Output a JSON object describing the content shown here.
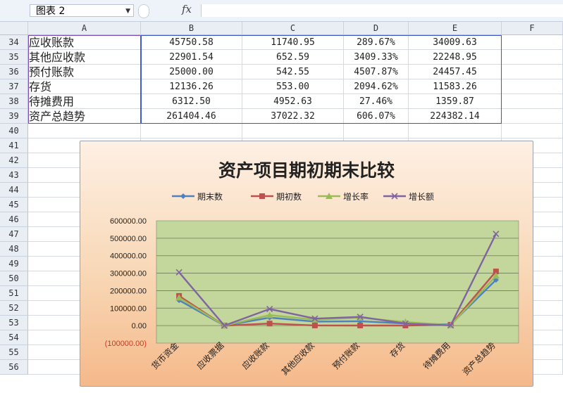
{
  "formula_bar": {
    "name_box": "图表 2",
    "fx_label": "fx",
    "formula": ""
  },
  "columns": [
    "A",
    "B",
    "C",
    "D",
    "E",
    "F"
  ],
  "rows": [
    {
      "num": "34",
      "a": "应收账款",
      "b": "45750.58",
      "c": "11740.95",
      "d": "289.67%",
      "e": "34009.63"
    },
    {
      "num": "35",
      "a": "其他应收款",
      "b": "22901.54",
      "c": "652.59",
      "d": "3409.33%",
      "e": "22248.95"
    },
    {
      "num": "36",
      "a": "预付账款",
      "b": "25000.00",
      "c": "542.55",
      "d": "4507.87%",
      "e": "24457.45"
    },
    {
      "num": "37",
      "a": "存货",
      "b": "12136.26",
      "c": "553.00",
      "d": "2094.62%",
      "e": "11583.26"
    },
    {
      "num": "38",
      "a": "待摊费用",
      "b": "6312.50",
      "c": "4952.63",
      "d": "27.46%",
      "e": "1359.87"
    },
    {
      "num": "39",
      "a": "资产总趋势",
      "b": "261404.46",
      "c": "37022.32",
      "d": "606.07%",
      "e": "224382.14"
    }
  ],
  "empty_rows": [
    "40",
    "41",
    "42",
    "43",
    "44",
    "45",
    "46",
    "47",
    "48",
    "49",
    "50",
    "51",
    "52",
    "53",
    "54",
    "55",
    "56"
  ],
  "colors": {
    "plot_bg": "#c3d69b",
    "期末数": "#4f81bd",
    "期初数": "#c0504d",
    "增长率": "#9bbb59",
    "增长额": "#8064a2",
    "negative_tick": "#e03020"
  },
  "chart_data": {
    "type": "line",
    "title": "资产项目期初期末比较",
    "categories": [
      "货币资金",
      "应收票据",
      "应收账款",
      "其他应收款",
      "预付账款",
      "存货",
      "待摊费用",
      "资产总趋势"
    ],
    "ylim": [
      -100000,
      600000
    ],
    "yticks": [
      "(100000.00)",
      "0.00",
      "100000.00",
      "200000.00",
      "300000.00",
      "400000.00",
      "500000.00",
      "600000.00"
    ],
    "ytick_values": [
      -100000,
      0,
      100000,
      200000,
      300000,
      400000,
      500000,
      600000
    ],
    "legend_position": "top",
    "grid": true,
    "series": [
      {
        "name": "期末数",
        "marker": "diamond",
        "values": [
          145000,
          0,
          45750.58,
          22901.54,
          25000,
          12136.26,
          6312.5,
          261404.46
        ]
      },
      {
        "name": "期初数",
        "marker": "square",
        "values": [
          170000,
          0,
          11740.95,
          652.59,
          542.55,
          553,
          4952.63,
          310000
        ]
      },
      {
        "name": "增长率",
        "marker": "triangle",
        "values": [
          160000,
          0,
          60000,
          34000,
          45000,
          21000,
          2000,
          285000
        ]
      },
      {
        "name": "增长额",
        "marker": "x",
        "values": [
          305000,
          0,
          95000,
          40000,
          50000,
          12000,
          1360,
          525000
        ]
      }
    ]
  }
}
